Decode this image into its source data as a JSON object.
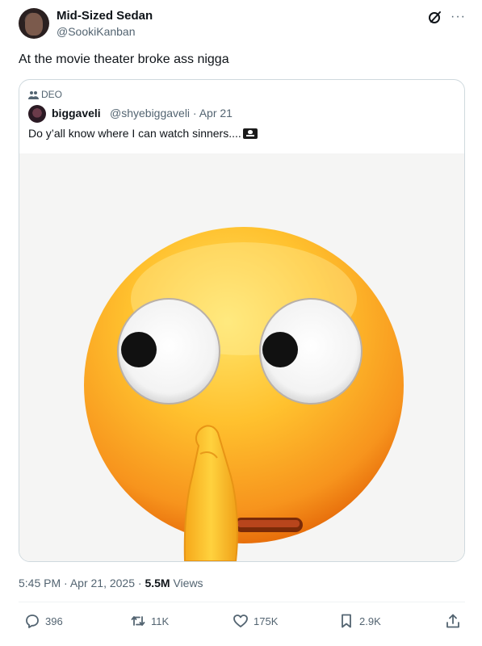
{
  "post": {
    "display_name": "Mid-Sized Sedan",
    "handle": "@SookiKanban",
    "text": "At the movie theater broke ass nigga",
    "time": "5:45 PM",
    "separator": "·",
    "date": "Apr 21, 2025",
    "views_count": "5.5M",
    "views_label": "Views"
  },
  "quote": {
    "community": "DEO",
    "display_name": "biggaveli",
    "meta": "@shyebiggaveli · Apr 21",
    "text": "Do y’all know where I can watch sinners....",
    "media_emoji": "shushing-face-emoji"
  },
  "actions": {
    "replies": "396",
    "reposts": "11K",
    "likes": "175K",
    "bookmarks": "2.9K"
  },
  "icons": [
    "grok-icon",
    "more-icon",
    "people-icon",
    "pirate-flag-icon",
    "reply-icon",
    "repost-icon",
    "like-icon",
    "bookmark-icon",
    "share-icon"
  ],
  "colors": {
    "text": "#0f1419",
    "secondary": "#536471",
    "border": "#cfd9de"
  }
}
